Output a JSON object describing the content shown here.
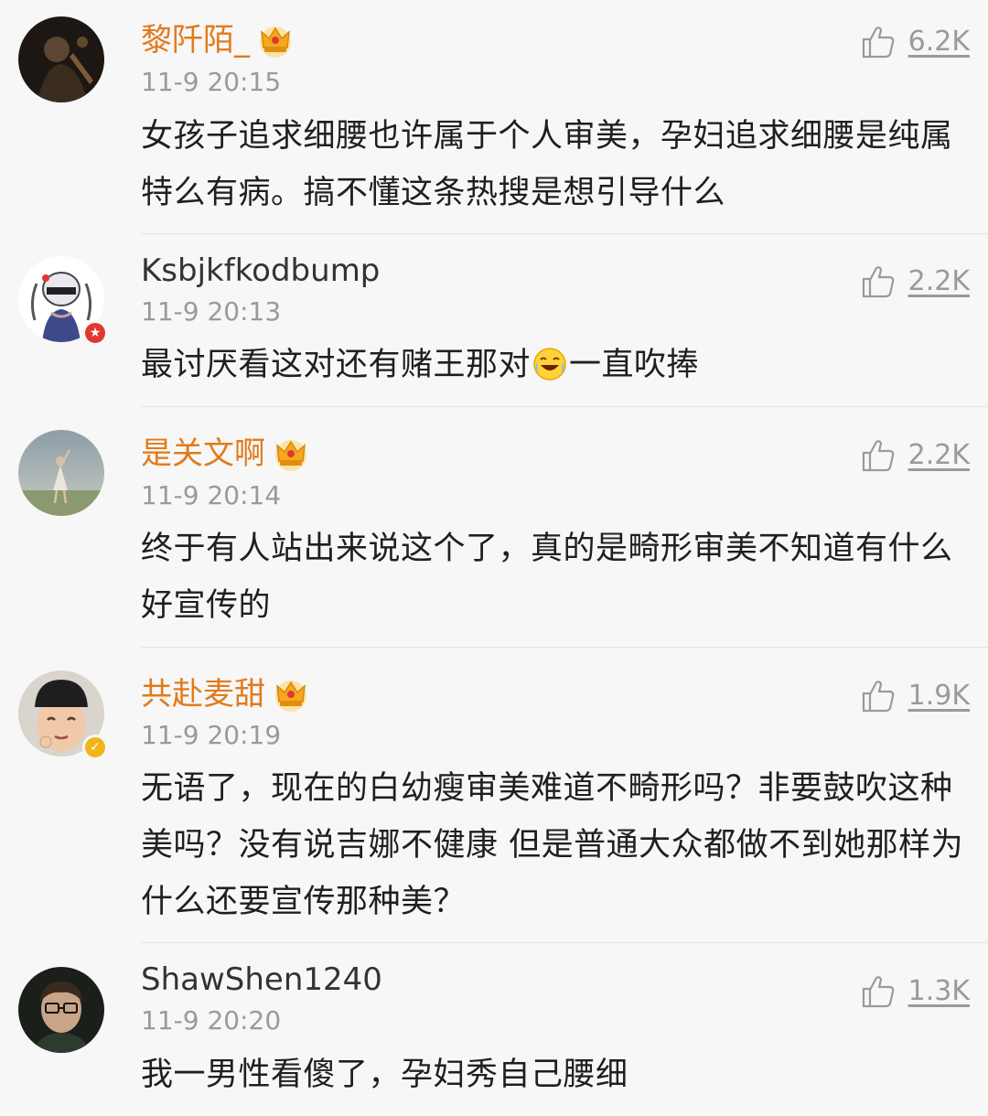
{
  "comments": [
    {
      "username": "黎阡陌_",
      "vip": true,
      "time": "11-9 20:15",
      "likes": "6.2K",
      "text": "女孩子追求细腰也许属于个人审美，孕妇追求细腰是纯属特么有病。搞不懂这条热搜是想引导什么",
      "avatar_icon": "avatar-dark-photo-icon"
    },
    {
      "username": "Ksbjkfkodbump",
      "vip": false,
      "time": "11-9 20:13",
      "likes": "2.2K",
      "text_before": "最讨厌看这对还有赌王那对",
      "text_after": "一直吹捧",
      "emoji_icon": "laughing-crying-emoji-icon",
      "avatar_icon": "avatar-cartoon-helmet-icon",
      "badge_color": "#e0382e"
    },
    {
      "username": "是关文啊",
      "vip": true,
      "time": "11-9 20:14",
      "likes": "2.2K",
      "text": "终于有人站出来说这个了，真的是畸形审美不知道有什么好宣传的",
      "avatar_icon": "avatar-dancer-photo-icon"
    },
    {
      "username": "共赴麦甜",
      "vip": true,
      "time": "11-9 20:19",
      "likes": "1.9K",
      "text": "无语了，现在的白幼瘦审美难道不畸形吗？非要鼓吹这种美吗？没有说吉娜不健康 但是普通大众都做不到她那样为什么还要宣传那种美？",
      "avatar_icon": "avatar-person-hat-icon",
      "badge_color": "#f2b418"
    },
    {
      "username": "ShawShen1240",
      "vip": false,
      "time": "11-9 20:20",
      "likes": "1.3K",
      "text": "我一男性看傻了，孕妇秀自己腰细",
      "avatar_icon": "avatar-man-glasses-icon"
    }
  ],
  "colors": {
    "background": "#f7f7f7",
    "vip_name": "#e27a1b",
    "normal_name": "#333333",
    "meta_gray": "#9a9a9a",
    "text": "#1f1f1f",
    "crown_gold": "#f4a81d"
  }
}
